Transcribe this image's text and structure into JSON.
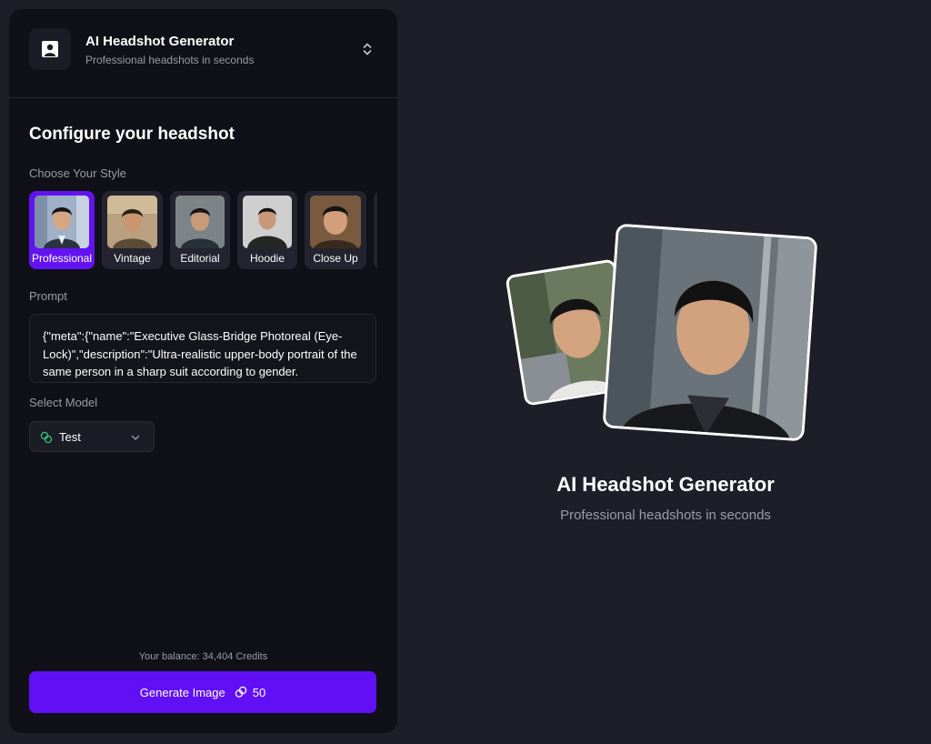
{
  "app": {
    "title": "AI Headshot Generator",
    "subtitle": "Professional headshots in seconds"
  },
  "config": {
    "heading": "Configure your headshot",
    "style_label": "Choose Your Style",
    "styles": [
      {
        "label": "Professional",
        "selected": true
      },
      {
        "label": "Vintage",
        "selected": false
      },
      {
        "label": "Editorial",
        "selected": false
      },
      {
        "label": "Hoodie",
        "selected": false
      },
      {
        "label": "Close Up",
        "selected": false
      }
    ],
    "prompt_label": "Prompt",
    "prompt_value": "{\"meta\":{\"name\":\"Executive Glass-Bridge Photoreal (Eye-Lock)\",\"description\":\"Ultra-realistic upper-body portrait of the same person in a sharp suit according to gender.",
    "model_label": "Select Model",
    "model_value": "Test"
  },
  "footer": {
    "balance": "Your balance: 34,404 Credits",
    "generate_label": "Generate Image",
    "generate_cost": "50"
  },
  "hero": {
    "title": "AI Headshot Generator",
    "subtitle": "Professional headshots in seconds"
  },
  "colors": {
    "accent": "#6110f5",
    "panel": "#0f1018",
    "background": "#1e1e28"
  }
}
